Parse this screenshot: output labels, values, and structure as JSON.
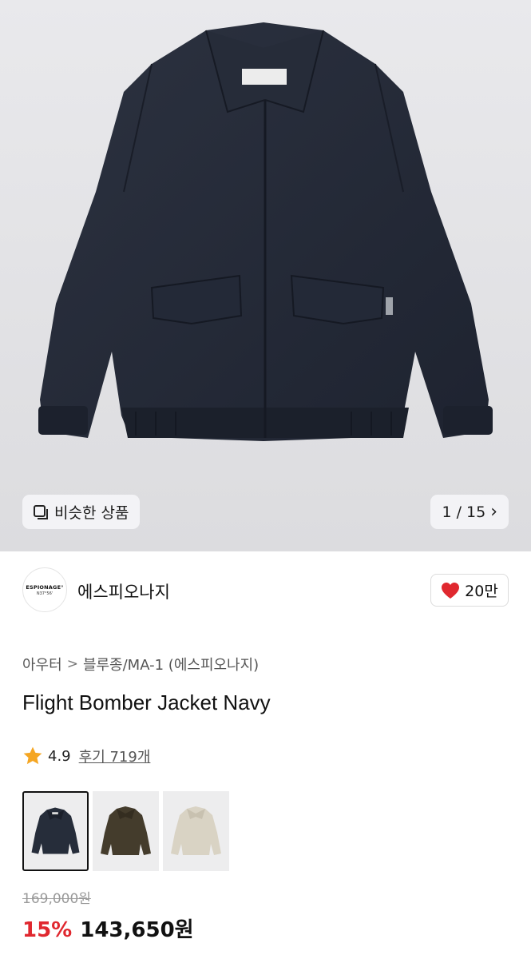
{
  "gallery": {
    "similar_button_label": "비슷한 상품",
    "counter_text": "1 / 15",
    "chevron": "›",
    "image_subject": "navy bomber jacket"
  },
  "brand": {
    "logo_line1": "ESPIONAGE°",
    "logo_line2": "N37°56'",
    "name": "에스피오나지",
    "likes": "20만",
    "like_color": "#e0282f"
  },
  "product": {
    "breadcrumb": [
      "아우터",
      "블루종/MA-1 (에스피오나지)"
    ],
    "breadcrumb_separator": ">",
    "title": "Flight Bomber Jacket Navy",
    "rating": "4.9",
    "reviews": "후기 719개",
    "star_color": "#f5a623",
    "color_options": [
      {
        "name": "navy",
        "color": "#262d3a",
        "selected": true
      },
      {
        "name": "olive",
        "color": "#443c2c",
        "selected": false
      },
      {
        "name": "ivory",
        "color": "#d9d3c4",
        "selected": false
      }
    ],
    "original_price": "169,000원",
    "discount": "15%",
    "sale_price": "143,650원",
    "discount_color": "#e0282f"
  }
}
